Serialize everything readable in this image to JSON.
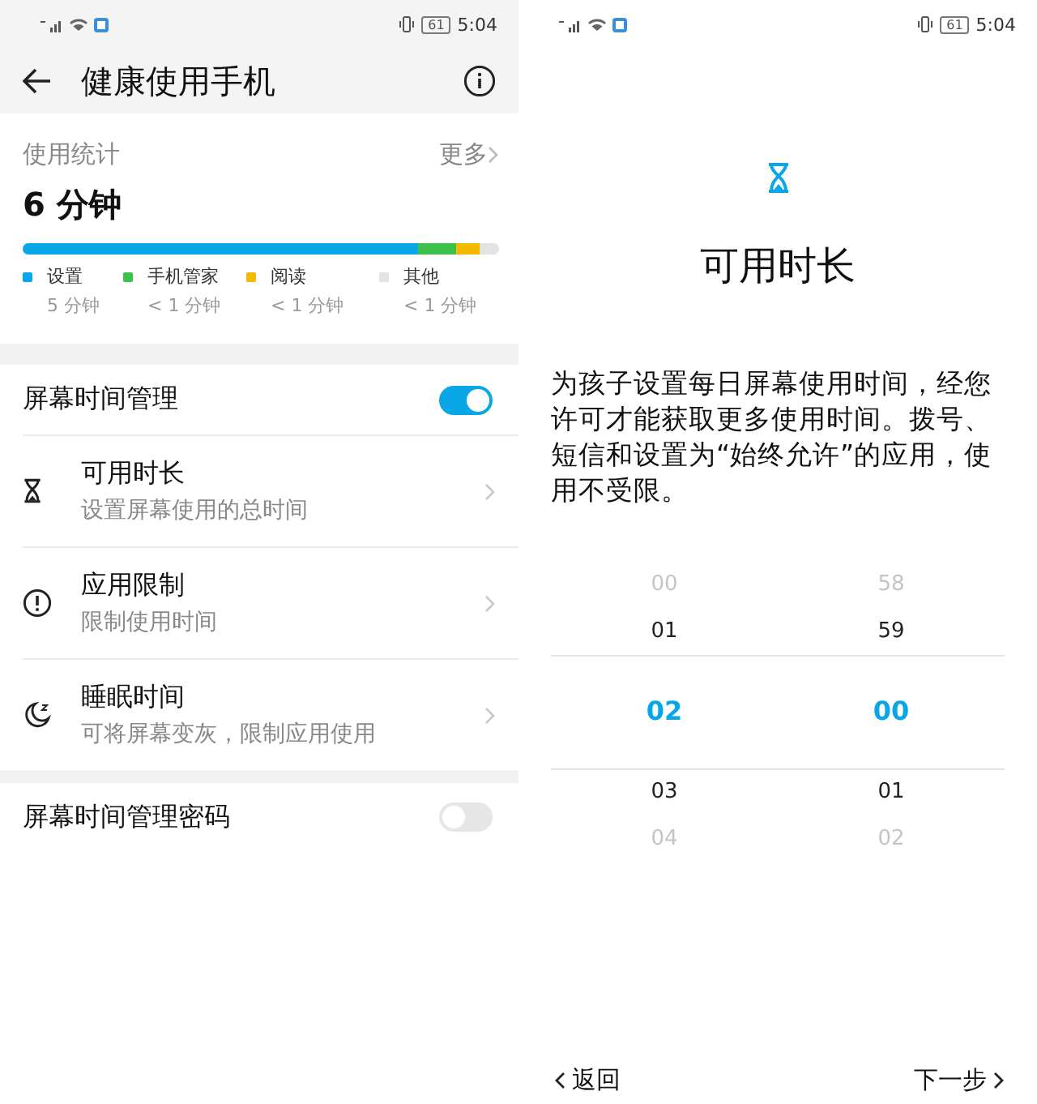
{
  "left_screen": {
    "status_bar": {
      "battery": "61",
      "time": "5:04"
    },
    "header": {
      "title": "健康使用手机"
    },
    "usage": {
      "title": "使用统计",
      "more": "更多",
      "total": "6 分钟",
      "legend": [
        {
          "color": "#0aa7e8",
          "name": "设置",
          "time": "5 分钟"
        },
        {
          "color": "#3cc24a",
          "name": "手机管家",
          "time": "< 1 分钟"
        },
        {
          "color": "#f5b800",
          "name": "阅读",
          "time": "< 1 分钟"
        },
        {
          "color": "#e3e3e3",
          "name": "其他",
          "time": "< 1 分钟"
        }
      ]
    },
    "screen_time": {
      "label": "屏幕时间管理",
      "on": true
    },
    "items": [
      {
        "kind": "hourglass",
        "title": "可用时长",
        "subtitle": "设置屏幕使用的总时间"
      },
      {
        "kind": "alert",
        "title": "应用限制",
        "subtitle": "限制使用时间"
      },
      {
        "kind": "moon",
        "title": "睡眠时间",
        "subtitle": "可将屏幕变灰，限制应用使用"
      }
    ],
    "password": {
      "label": "屏幕时间管理密码",
      "on": false
    }
  },
  "right_screen": {
    "status_bar": {
      "battery": "61",
      "time": "5:04"
    },
    "title": "可用时长",
    "description": "为孩子设置每日屏幕使用时间，经您许可才能获取更多使用时间。拨号、短信和设置为“始终允许”的应用，使用不受限。",
    "picker": {
      "hours": [
        {
          "value": "00",
          "selected": false
        },
        {
          "value": "01",
          "selected": false
        },
        {
          "value": "02",
          "selected": true
        },
        {
          "value": "03",
          "selected": false
        },
        {
          "value": "04",
          "selected": false
        }
      ],
      "minutes": [
        {
          "value": "58",
          "selected": false
        },
        {
          "value": "59",
          "selected": false
        },
        {
          "value": "00",
          "selected": true
        },
        {
          "value": "01",
          "selected": false
        },
        {
          "value": "02",
          "selected": false
        }
      ]
    },
    "back": "返回",
    "next": "下一步"
  }
}
